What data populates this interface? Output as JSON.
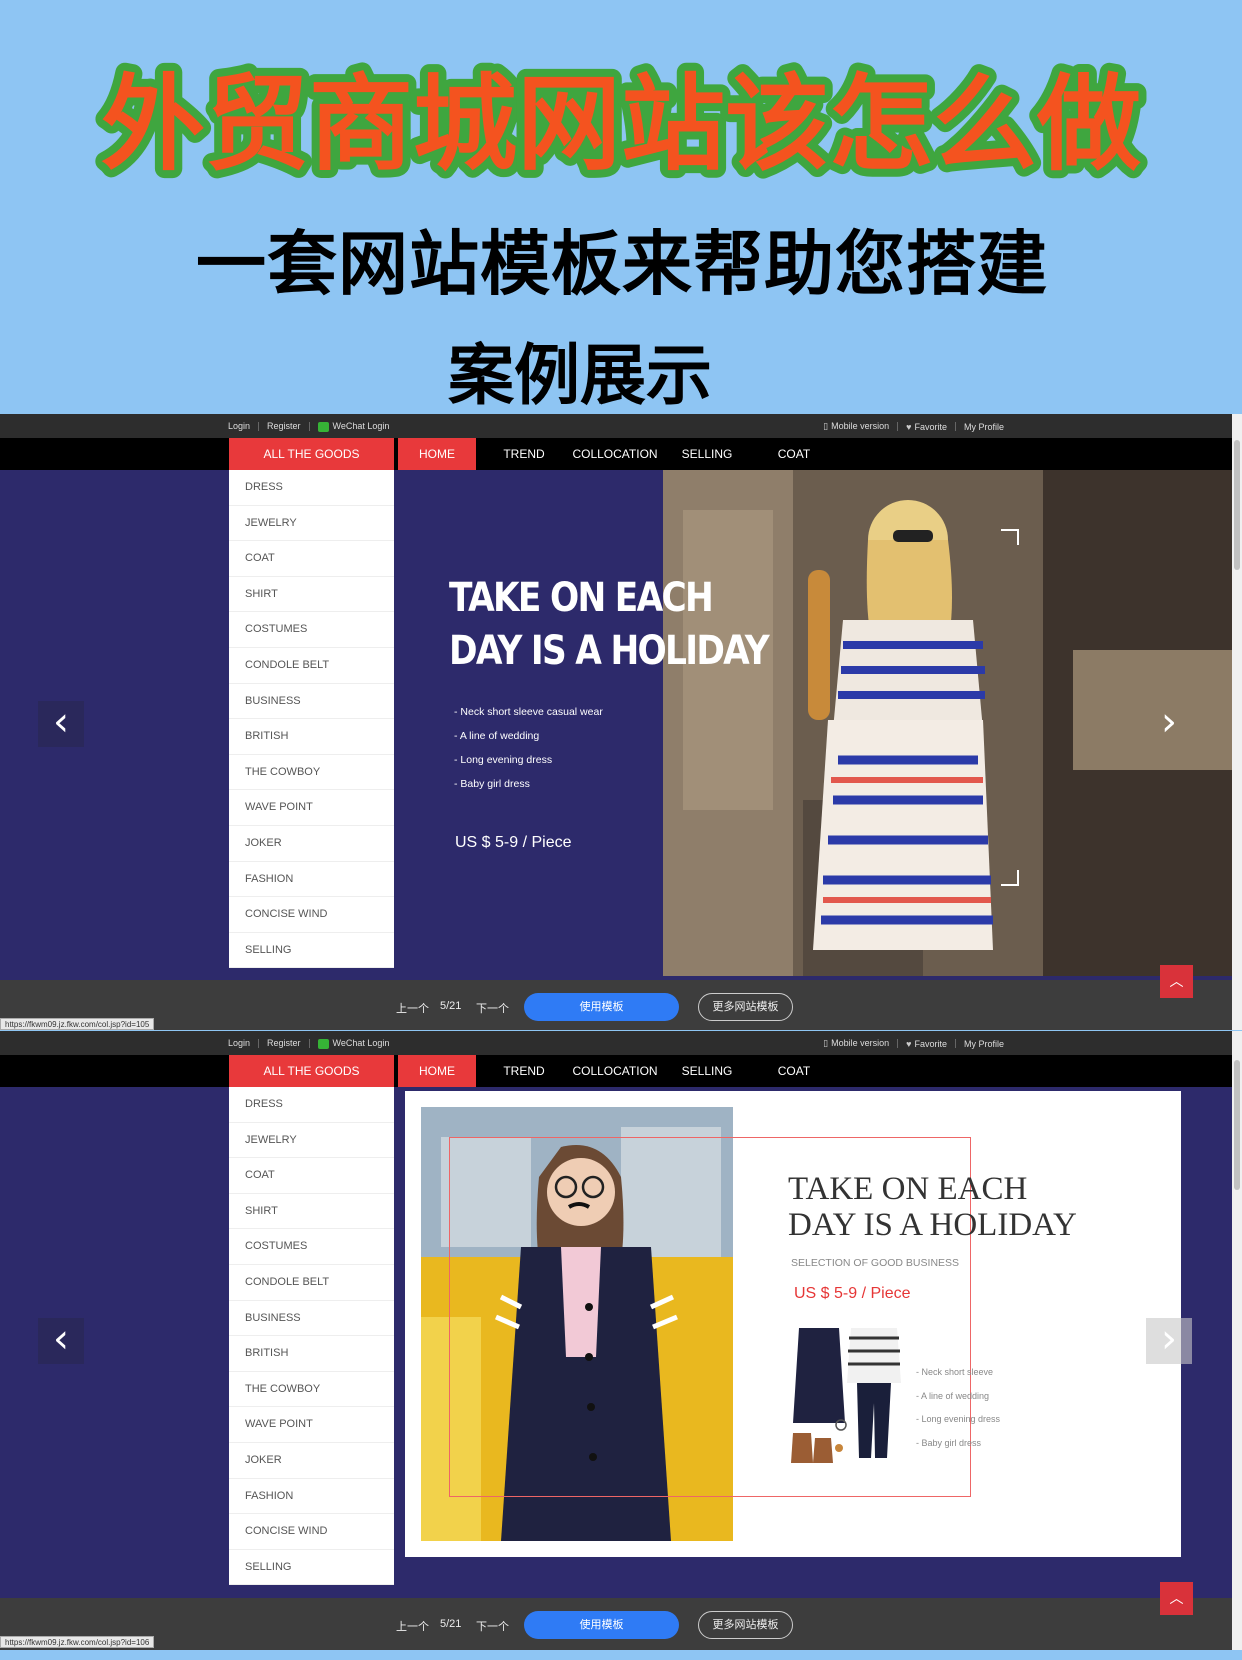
{
  "hero": {
    "title": "外贸商城网站该怎么做",
    "subtitle": "一套网站模板来帮助您搭建",
    "case_label": "案例展示"
  },
  "colors": {
    "page_bg": "#8ec5f3",
    "title_fill": "#f4531f",
    "title_stroke": "#3fa63f",
    "accent_red": "#e8393b",
    "slide_bg": "#2d2a6b",
    "use_button": "#2f7bf5"
  },
  "screens": [
    {
      "topbar": {
        "login": "Login",
        "register": "Register",
        "wechat_login": "WeChat Login",
        "mobile": "Mobile version",
        "favorite": "Favorite",
        "profile": "My Profile"
      },
      "nav": {
        "all_goods": "ALL THE GOODS",
        "home": "HOME",
        "trend": "TREND",
        "collocation": "COLLOCATION",
        "selling": "SELLING",
        "coat": "COAT"
      },
      "menu": [
        "DRESS",
        "JEWELRY",
        "COAT",
        "SHIRT",
        "COSTUMES",
        "CONDOLE BELT",
        "BUSINESS",
        "BRITISH",
        "THE COWBOY",
        "WAVE POINT",
        "JOKER",
        "FASHION",
        "CONCISE WIND",
        "SELLING"
      ],
      "slide": {
        "headline_1": "TAKE ON EACH",
        "headline_2": "DAY IS A HOLIDAY",
        "items": [
          "-  Neck short sleeve casual wear",
          "-  A line of wedding",
          "-  Long evening dress",
          "-  Baby girl dress"
        ],
        "price": "US $ 5-9 / Piece"
      },
      "bottom": {
        "prev": "上一个",
        "page": "5/21",
        "next": "下一个",
        "use_template": "使用模板",
        "more_templates": "更多网站模板"
      },
      "status_url": "https://fkwm09.jz.fkw.com/col.jsp?id=105"
    },
    {
      "topbar": {
        "login": "Login",
        "register": "Register",
        "wechat_login": "WeChat Login",
        "mobile": "Mobile version",
        "favorite": "Favorite",
        "profile": "My Profile"
      },
      "nav": {
        "all_goods": "ALL THE GOODS",
        "home": "HOME",
        "trend": "TREND",
        "collocation": "COLLOCATION",
        "selling": "SELLING",
        "coat": "COAT"
      },
      "menu": [
        "DRESS",
        "JEWELRY",
        "COAT",
        "SHIRT",
        "COSTUMES",
        "CONDOLE BELT",
        "BUSINESS",
        "BRITISH",
        "THE COWBOY",
        "WAVE POINT",
        "JOKER",
        "FASHION",
        "CONCISE WIND",
        "SELLING"
      ],
      "slide": {
        "headline_1": "TAKE ON EACH",
        "headline_2": "DAY IS A HOLIDAY",
        "selection": "SELECTION OF GOOD BUSINESS",
        "price": "US $ 5-9 / Piece",
        "items": [
          "-  Neck short sleeve",
          "-  A line of wedding",
          "-  Long evening dress",
          "-  Baby girl dress"
        ]
      },
      "bottom": {
        "prev": "上一个",
        "page": "5/21",
        "next": "下一个",
        "use_template": "使用模板",
        "more_templates": "更多网站模板"
      },
      "status_url": "https://fkwm09.jz.fkw.com/col.jsp?id=106"
    }
  ]
}
